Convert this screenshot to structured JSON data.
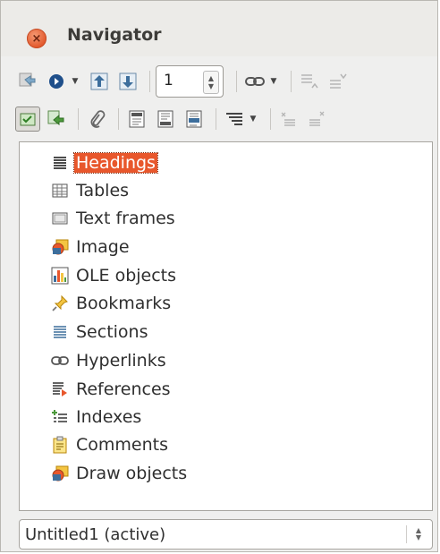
{
  "window": {
    "title": "Navigator"
  },
  "toolbar": {
    "page_value": "1"
  },
  "tree": {
    "items": [
      {
        "label": "Headings",
        "icon": "headings-icon",
        "selected": true
      },
      {
        "label": "Tables",
        "icon": "table-icon"
      },
      {
        "label": "Text frames",
        "icon": "text-frame-icon"
      },
      {
        "label": "Image",
        "icon": "image-icon"
      },
      {
        "label": "OLE objects",
        "icon": "ole-chart-icon"
      },
      {
        "label": "Bookmarks",
        "icon": "bookmark-pin-icon"
      },
      {
        "label": "Sections",
        "icon": "sections-icon"
      },
      {
        "label": "Hyperlinks",
        "icon": "hyperlink-icon"
      },
      {
        "label": "References",
        "icon": "references-icon"
      },
      {
        "label": "Indexes",
        "icon": "indexes-icon"
      },
      {
        "label": "Comments",
        "icon": "comments-icon"
      },
      {
        "label": "Draw objects",
        "icon": "draw-objects-icon"
      }
    ]
  },
  "document_select": {
    "value": "Untitled1 (active)"
  },
  "colors": {
    "accent": "#e8572c",
    "close": "#e2572b"
  }
}
